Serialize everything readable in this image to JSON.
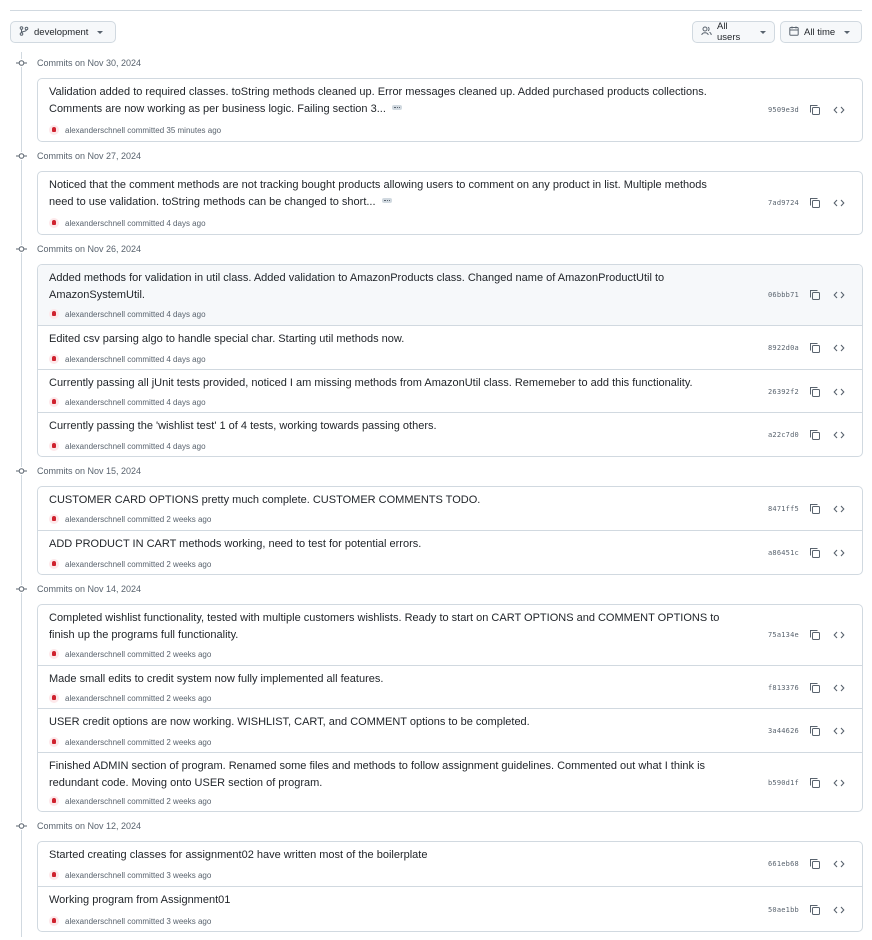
{
  "toolbar": {
    "branch_label": "development",
    "users_label": "All users",
    "time_label": "All time"
  },
  "groups": [
    {
      "label": "Commits on Nov 30, 2024",
      "commits": [
        {
          "message": "Validation added to required classes. toString methods cleaned up. Error messages cleaned up. Added purchased products collections. Comments are now working as per business logic. Failing section 3...",
          "truncated": true,
          "meta": "alexanderschnell committed 35 minutes ago",
          "sha": "9509e3d"
        }
      ]
    },
    {
      "label": "Commits on Nov 27, 2024",
      "commits": [
        {
          "message": "Noticed that the comment methods are not tracking bought products allowing users to comment on any product in list. Multiple methods need to use validation. toString methods can be changed to short...",
          "truncated": true,
          "meta": "alexanderschnell committed 4 days ago",
          "sha": "7ad9724"
        }
      ]
    },
    {
      "label": "Commits on Nov 26, 2024",
      "commits": [
        {
          "message": "Added methods for validation in util class. Added validation to AmazonProducts class. Changed name of AmazonProductUtil to AmazonSystemUtil.",
          "truncated": false,
          "meta": "alexanderschnell committed 4 days ago",
          "sha": "06bbb71"
        },
        {
          "message": "Edited csv parsing algo to handle special char. Starting util methods now.",
          "truncated": false,
          "meta": "alexanderschnell committed 4 days ago",
          "sha": "8922d0a"
        },
        {
          "message": "Currently passing all jUnit tests provided, noticed I am missing methods from AmazonUtil class. Rememeber to add this functionality.",
          "truncated": false,
          "meta": "alexanderschnell committed 4 days ago",
          "sha": "26392f2"
        },
        {
          "message": "Currently passing the 'wishlist test' 1 of 4 tests, working towards passing others.",
          "truncated": false,
          "meta": "alexanderschnell committed 4 days ago",
          "sha": "a22c7d0"
        }
      ]
    },
    {
      "label": "Commits on Nov 15, 2024",
      "commits": [
        {
          "message": "CUSTOMER CARD OPTIONS pretty much complete. CUSTOMER COMMENTS TODO.",
          "truncated": false,
          "meta": "alexanderschnell committed 2 weeks ago",
          "sha": "8471ff5"
        },
        {
          "message": "ADD PRODUCT IN CART methods working, need to test for potential errors.",
          "truncated": false,
          "meta": "alexanderschnell committed 2 weeks ago",
          "sha": "a86451c"
        }
      ]
    },
    {
      "label": "Commits on Nov 14, 2024",
      "commits": [
        {
          "message": "Completed wishlist functionality, tested with multiple customers wishlists. Ready to start on CART OPTIONS and COMMENT OPTIONS to finish up the programs full functionality.",
          "truncated": false,
          "meta": "alexanderschnell committed 2 weeks ago",
          "sha": "75a134e"
        },
        {
          "message": "Made small edits to credit system now fully implemented all features.",
          "truncated": false,
          "meta": "alexanderschnell committed 2 weeks ago",
          "sha": "f813376"
        },
        {
          "message": "USER credit options are now working. WISHLIST, CART, and COMMENT options to be completed.",
          "truncated": false,
          "meta": "alexanderschnell committed 2 weeks ago",
          "sha": "3a44626"
        },
        {
          "message": "Finished ADMIN section of program. Renamed some files and methods to follow assignment guidelines. Commented out what I think is redundant code. Moving onto USER section of program.",
          "truncated": false,
          "meta": "alexanderschnell committed 2 weeks ago",
          "sha": "b590d1f"
        }
      ]
    },
    {
      "label": "Commits on Nov 12, 2024",
      "commits": [
        {
          "message": "Started creating classes for assignment02 have written most of the boilerplate",
          "truncated": false,
          "meta": "alexanderschnell committed 3 weeks ago",
          "sha": "661eb68"
        },
        {
          "message": "Working program from Assignment01",
          "truncated": false,
          "meta": "alexanderschnell committed 3 weeks ago",
          "sha": "50ae1bb"
        }
      ]
    }
  ]
}
